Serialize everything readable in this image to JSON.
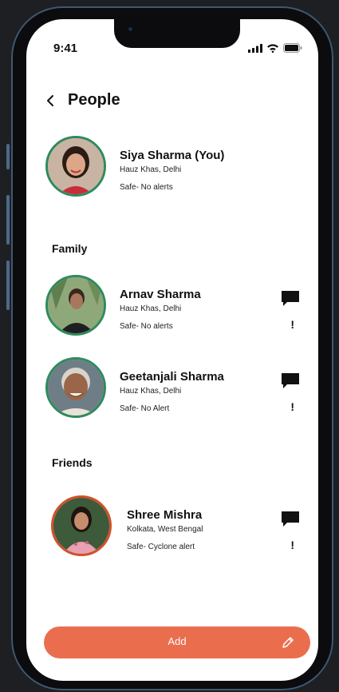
{
  "status_bar": {
    "time": "9:41",
    "icons": [
      "signal-icon",
      "wifi-icon",
      "battery-icon"
    ]
  },
  "header": {
    "back_icon": "chevron-left-icon",
    "title": "People"
  },
  "me": {
    "name": "Siya Sharma (You)",
    "location": "Hauz Khas, Delhi",
    "status": "Safe- No alerts"
  },
  "sections": {
    "family": "Family",
    "friends": "Friends"
  },
  "family": [
    {
      "name": "Arnav Sharma",
      "location": "Hauz Khas, Delhi",
      "status": "Safe- No alerts",
      "alert_mark": "!"
    },
    {
      "name": "Geetanjali Sharma",
      "location": "Hauz Khas, Delhi",
      "status": "Safe- No Alert",
      "alert_mark": "!"
    }
  ],
  "friends": [
    {
      "name": "Shree Mishra",
      "location": "Kolkata, West Bengal",
      "status": "Safe- Cyclone alert",
      "alert_mark": "!"
    }
  ],
  "add_button": {
    "label": "Add",
    "icon": "pencil-icon"
  },
  "colors": {
    "accent": "#EA6E4E",
    "safe_ring": "#2F8A5C",
    "alert_ring": "#D2502A"
  }
}
